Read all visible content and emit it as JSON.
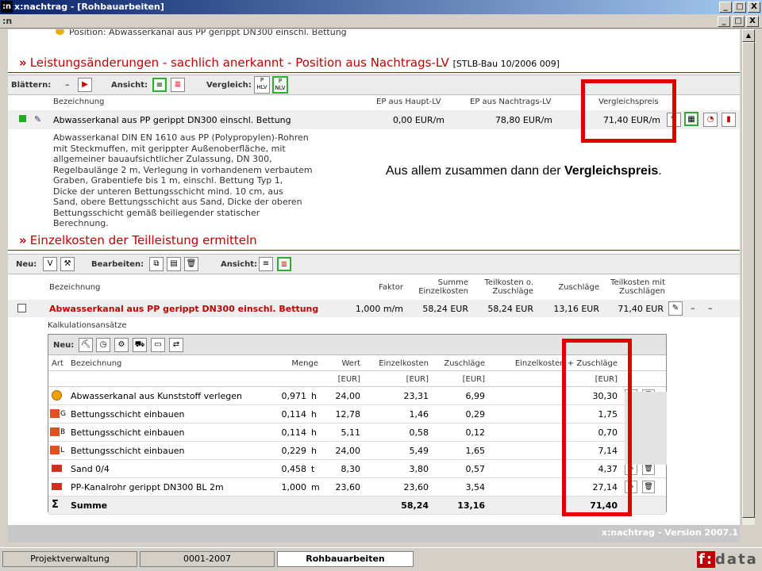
{
  "window": {
    "title": "x:nachtrag - [Rohbauarbeiten]",
    "app_icon": ":n",
    "controls": [
      "_",
      "□",
      "X"
    ]
  },
  "mdi": {
    "icon": ":n",
    "controls": [
      "_",
      "□",
      "X"
    ]
  },
  "top_cut": "Position: Abwasserkanal aus PP gerippt DN300 einschl. Bettung",
  "section1": {
    "title": "Leistungsänderungen - sachlich anerkannt - Position aus Nachtrags-LV",
    "ref": "[STLB-Bau 10/2006 009]",
    "toolbar": {
      "blaettern": "Blättern:",
      "dash": "–",
      "ansicht": "Ansicht:",
      "vergleich": "Vergleich:",
      "p_hlv": "P HLV",
      "p_nlv": "P NLV"
    },
    "headers": {
      "bez": "Bezeichnung",
      "ep_haupt": "EP aus Haupt-LV",
      "ep_nachtrag": "EP aus Nachtrags-LV",
      "vergleich": "Vergleichspreis"
    },
    "row": {
      "bez": "Abwasserkanal aus PP gerippt DN300 einschl. Bettung",
      "ep_haupt": "0,00 EUR/m",
      "ep_nachtrag": "78,80 EUR/m",
      "vergleich": "71,40 EUR/m"
    },
    "desc": [
      "Abwasserkanal DIN EN 1610 aus PP (Polypropylen)-Rohren",
      "mit Steckmuffen, mit gerippter Außenoberfläche, mit",
      "allgemeiner bauaufsichtlicher Zulassung, DN 300,",
      "Regelbaulänge 2 m, Verlegung in vorhandenem verbautem",
      "Graben, Grabentiefe bis 1 m, einschl. Bettung Typ 1,",
      "Dicke der unteren Bettungsschicht mind. 10 cm, aus",
      "Sand, obere Bettungsschicht aus Sand, Dicke der oberen",
      "Bettungsschicht gemäß beiliegender statischer",
      "Berechnung."
    ]
  },
  "annotation": {
    "pre": "Aus allem zusammen dann der ",
    "bold": "Vergleichspreis",
    "post": "."
  },
  "section2": {
    "title": "Einzelkosten der Teilleistung ermitteln",
    "toolbar": {
      "neu": "Neu:",
      "bearbeiten": "Bearbeiten:",
      "ansicht": "Ansicht:",
      "v": "V"
    },
    "headers": {
      "bez": "Bezeichnung",
      "faktor": "Faktor",
      "summe": "Summe Einzelkosten",
      "teil_o": "Teilkosten o. Zuschläge",
      "zuschl": "Zuschläge",
      "teil_m": "Teilkosten mit Zuschlägen"
    },
    "row": {
      "bez": "Abwasserkanal aus PP gerippt DN300 einschl. Bettung",
      "faktor": "1,000 m/m",
      "summe": "58,24 EUR",
      "teil_o": "58,24 EUR",
      "zuschl": "13,16 EUR",
      "teil_m": "71,40 EUR",
      "d1": "–",
      "d2": "–"
    },
    "kalk_label": "Kalkulationsansätze",
    "grid": {
      "neu": "Neu:",
      "headers": {
        "art": "Art",
        "bez": "Bezeichnung",
        "menge": "Menge",
        "wert": "Wert",
        "ek": "Einzelkosten",
        "zu": "Zuschläge",
        "ekz": "Einzelkosten + Zuschläge"
      },
      "units": {
        "wert": "[EUR]",
        "ek": "[EUR]",
        "zu": "[EUR]",
        "ekz": "[EUR]"
      },
      "rows": [
        {
          "art": "clock",
          "sub": "",
          "bez": "Abwasserkanal aus Kunststoff verlegen",
          "menge": "0,971",
          "unit": "h",
          "wert": "24,00",
          "ek": "23,31",
          "zu": "6,99",
          "ekz": "30,30",
          "actions": true
        },
        {
          "art": "worker",
          "sub": "G",
          "bez": "Bettungsschicht einbauen",
          "menge": "0,114",
          "unit": "h",
          "wert": "12,78",
          "ek": "1,46",
          "zu": "0,29",
          "ekz": "1,75",
          "actions": true
        },
        {
          "art": "worker",
          "sub": "B",
          "bez": "Bettungsschicht einbauen",
          "menge": "0,114",
          "unit": "h",
          "wert": "5,11",
          "ek": "0,58",
          "zu": "0,12",
          "ekz": "0,70",
          "actions": false
        },
        {
          "art": "worker",
          "sub": "L",
          "bez": "Bettungsschicht einbauen",
          "menge": "0,229",
          "unit": "h",
          "wert": "24,00",
          "ek": "5,49",
          "zu": "1,65",
          "ekz": "7,14",
          "actions": false
        },
        {
          "art": "material",
          "sub": "",
          "bez": "Sand 0/4",
          "menge": "0,458",
          "unit": "t",
          "wert": "8,30",
          "ek": "3,80",
          "zu": "0,57",
          "ekz": "4,37",
          "actions": true
        },
        {
          "art": "material",
          "sub": "",
          "bez": "PP-Kanalrohr gerippt DN300 BL 2m",
          "menge": "1,000",
          "unit": "m",
          "wert": "23,60",
          "ek": "23,60",
          "zu": "3,54",
          "ekz": "27,14",
          "actions": true
        }
      ],
      "sum": {
        "sigma": "Σ",
        "label": "Summe",
        "ek": "58,24",
        "zu": "13,16",
        "ekz": "71,40"
      }
    }
  },
  "version": "x:nachtrag - Version 2007.1",
  "taskbar": {
    "tabs": [
      "Projektverwaltung",
      "0001-2007",
      "Rohbauarbeiten"
    ]
  },
  "brand": {
    "f": "f:",
    "rest": "data"
  }
}
